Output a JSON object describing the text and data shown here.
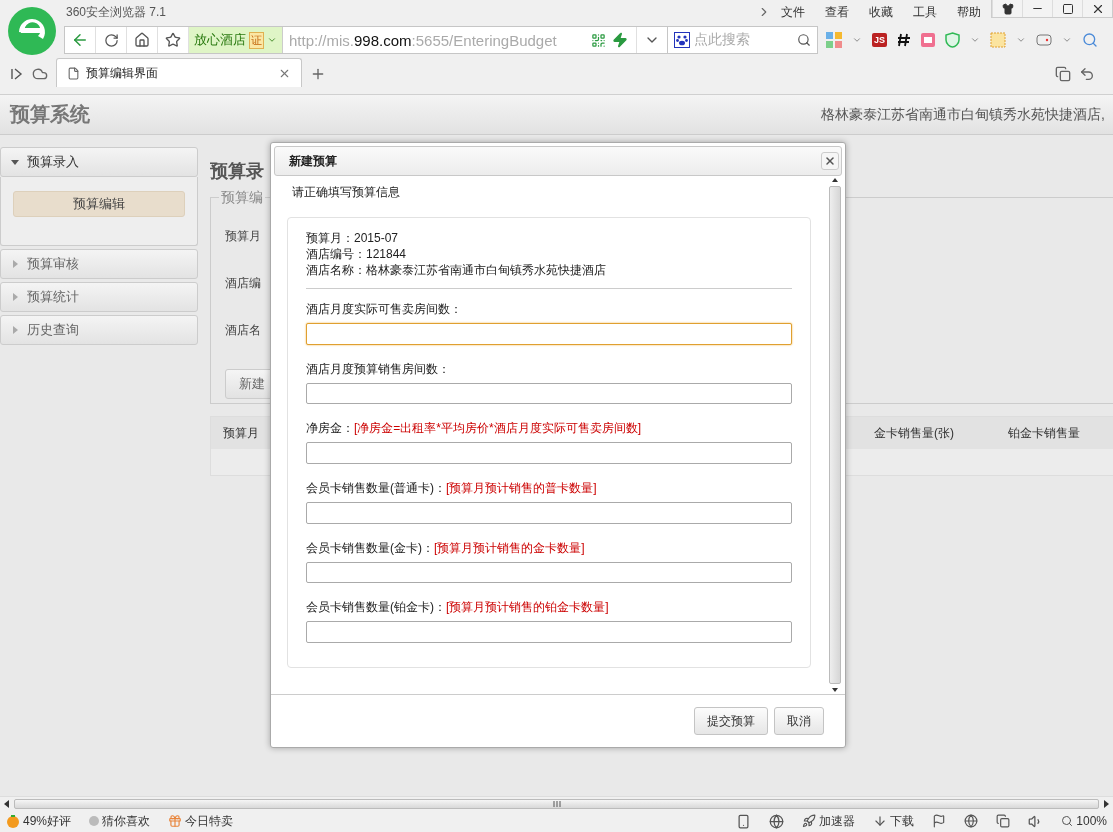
{
  "browser": {
    "title": "360安全浏览器 7.1",
    "menu": [
      "文件",
      "查看",
      "收藏",
      "工具",
      "帮助"
    ],
    "address": {
      "site_badge": "放心酒店",
      "cert": "证",
      "url_prefix": "http://mis.",
      "url_domain": "998.com",
      "url_suffix": ":5655/EnteringBudget"
    },
    "search": {
      "placeholder": "点此搜索"
    },
    "js_extension": "JS",
    "tabs": [
      {
        "label": "预算编辑界面",
        "selected": true
      }
    ]
  },
  "page": {
    "title": "预算系统",
    "hotel_banner": "格林豪泰江苏省南通市白甸镇秀水苑快捷酒店,"
  },
  "sidebar": [
    {
      "label": "预算录入",
      "expanded": true,
      "children": [
        {
          "label": "预算编辑",
          "selected": true
        }
      ]
    },
    {
      "label": "预算审核",
      "expanded": false
    },
    {
      "label": "预算统计",
      "expanded": false
    },
    {
      "label": "历史查询",
      "expanded": false
    }
  ],
  "main": {
    "heading": "预算录",
    "fieldset_legend": "预算编",
    "rows": [
      "预算月",
      "酒店编",
      "酒店名"
    ],
    "new_button": "新建",
    "table": {
      "columns": [
        {
          "label": "预算月"
        },
        {
          "label": "金卡销售量(张)"
        },
        {
          "label": "铂金卡销售量"
        }
      ]
    }
  },
  "dialog": {
    "title": "新建预算",
    "intro": "请正确填写预算信息",
    "info": [
      "预算月：2015-07",
      "酒店编号：121844",
      "酒店名称：格林豪泰江苏省南通市白甸镇秀水苑快捷酒店"
    ],
    "fields": [
      {
        "label": "酒店月度实际可售卖房间数：",
        "focused": true
      },
      {
        "label": "酒店月度预算销售房间数：",
        "focused": false
      },
      {
        "label": "净房金：",
        "hint": "[净房金=出租率*平均房价*酒店月度实际可售卖房间数]",
        "focused": false
      },
      {
        "label": "会员卡销售数量(普通卡)：",
        "hint": "[预算月预计销售的普卡数量]",
        "focused": false
      },
      {
        "label": "会员卡销售数量(金卡)：",
        "hint": "[预算月预计销售的金卡数量]",
        "focused": false
      },
      {
        "label": "会员卡销售数量(铂金卡)：",
        "hint": "[预算月预计销售的铂金卡数量]",
        "focused": false
      }
    ],
    "buttons": [
      "提交预算",
      "取消"
    ]
  },
  "status_bar": {
    "rating": "49%好评",
    "guess": "猜你喜欢",
    "deals": "今日特卖",
    "accelerator": "加速器",
    "download": "下载",
    "zoom": "100%"
  }
}
